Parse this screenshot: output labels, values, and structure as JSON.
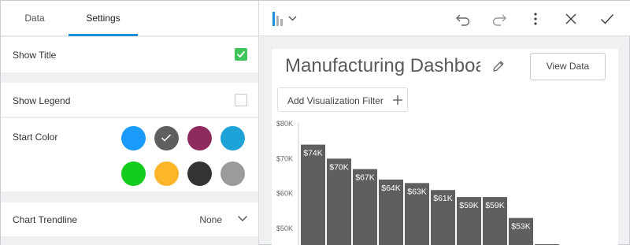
{
  "tabs": {
    "data": "Data",
    "settings": "Settings"
  },
  "settings": {
    "show_title": {
      "label": "Show Title",
      "checked": true
    },
    "show_legend": {
      "label": "Show Legend",
      "checked": false
    },
    "start_color": {
      "label": "Start Color",
      "swatches": [
        "#1a9bfc",
        "#5f5f5f",
        "#8e2a5e",
        "#1ea3d8",
        "#14cc1e",
        "#fdb62a",
        "#333333",
        "#9b9b9b"
      ],
      "selected_index": 1
    },
    "chart_trendline": {
      "label": "Chart Trendline",
      "value": "None"
    }
  },
  "toolbar": {
    "chart_type_icon": "bar-chart-icon",
    "undo_icon": "undo-icon",
    "redo_icon": "redo-icon",
    "more_icon": "more-vertical-icon",
    "close_icon": "close-icon",
    "confirm_icon": "check-icon"
  },
  "dashboard": {
    "title": "Manufacturing Dashboard",
    "view_data": "View Data",
    "add_filter": "Add Visualization Filter"
  },
  "chart_data": {
    "type": "bar",
    "y_ticks": [
      "$80K",
      "$70K",
      "$60K",
      "$50K"
    ],
    "values": [
      74,
      70,
      67,
      64,
      63,
      61,
      59,
      59,
      53
    ],
    "labels": [
      "$74K",
      "$70K",
      "$67K",
      "$64K",
      "$63K",
      "$61K",
      "$59K",
      "$59K",
      "$53K"
    ],
    "unit": "K",
    "color": "#5f5f5f",
    "ylim": [
      44,
      82
    ]
  }
}
